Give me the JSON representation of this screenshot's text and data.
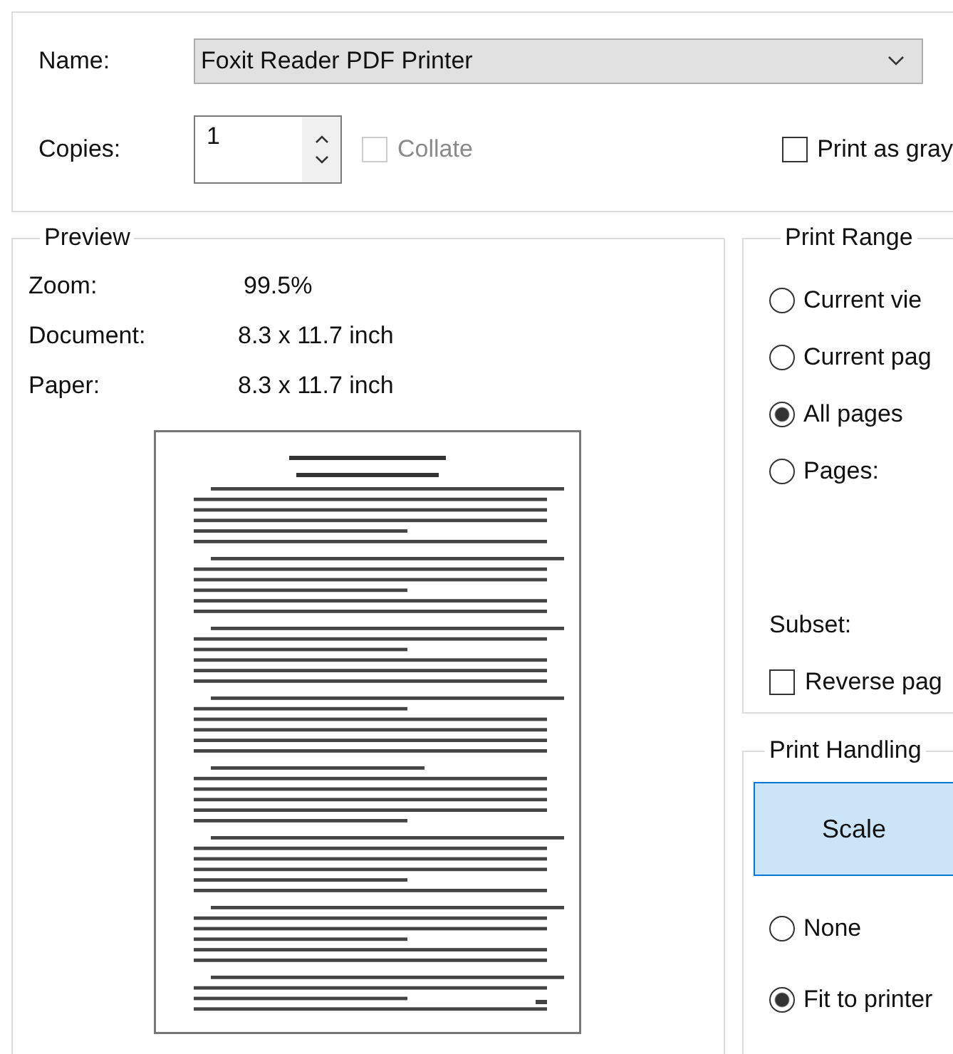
{
  "printer": {
    "label": "Name:",
    "value": "Foxit Reader PDF Printer"
  },
  "copies": {
    "label": "Copies:",
    "value": "1"
  },
  "collate": {
    "label": "Collate",
    "checked": false,
    "disabled": true
  },
  "print_as_gray": {
    "label": "Print as gray",
    "checked": false,
    "disabled": false
  },
  "preview": {
    "title": "Preview",
    "rows": [
      {
        "label": "Zoom:",
        "value": "99.5%"
      },
      {
        "label": "Document:",
        "value": "8.3 x 11.7 inch"
      },
      {
        "label": "Paper:",
        "value": "8.3 x 11.7 inch"
      }
    ]
  },
  "print_range": {
    "title": "Print Range",
    "options": [
      {
        "label": "Current vie",
        "selected": false
      },
      {
        "label": "Current pag",
        "selected": false
      },
      {
        "label": "All pages",
        "selected": true
      },
      {
        "label": "Pages:",
        "selected": false
      }
    ],
    "subset_label": "Subset:",
    "reverse": {
      "label": "Reverse pag",
      "checked": false
    }
  },
  "print_handling": {
    "title": "Print Handling",
    "tabs": [
      {
        "label": "Scale",
        "selected": true
      }
    ],
    "options": [
      {
        "label": "None",
        "selected": false
      },
      {
        "label": "Fit to printer",
        "selected": true
      }
    ]
  }
}
